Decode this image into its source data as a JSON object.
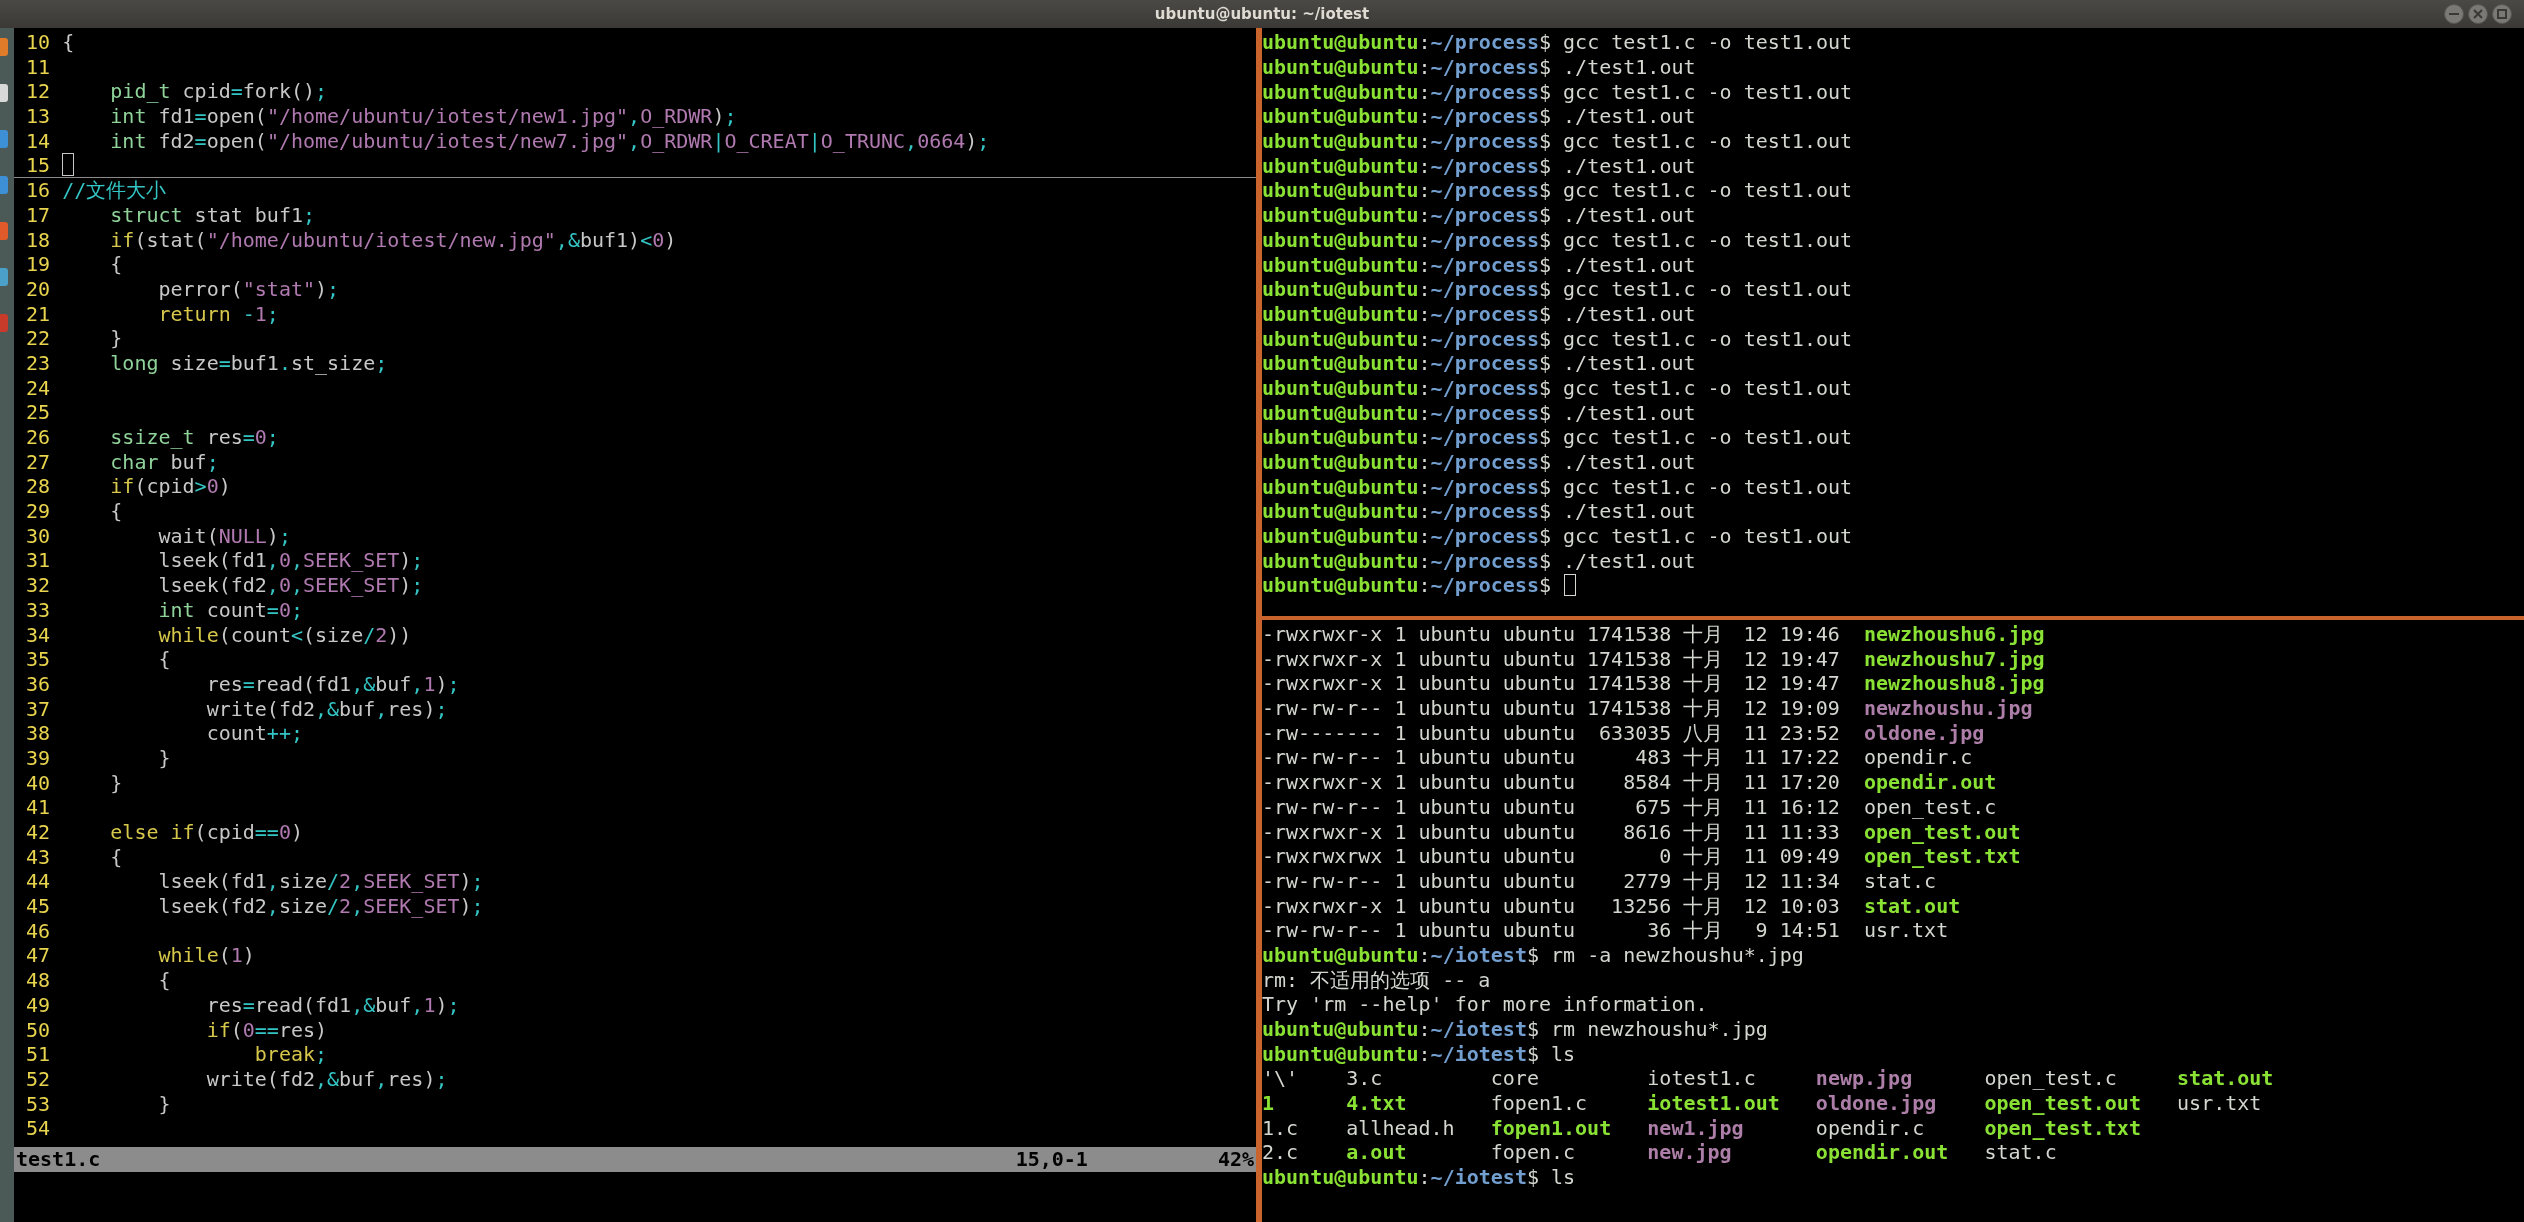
{
  "window": {
    "title": "ubuntu@ubuntu: ~/iotest"
  },
  "editor": {
    "lines": [
      {
        "number": "10",
        "cursor": false,
        "segments": [
          {
            "kind": "plain",
            "text": "{"
          }
        ]
      },
      {
        "number": "11",
        "cursor": false
      },
      {
        "number": "12",
        "cursor": false,
        "segments": [
          {
            "kind": "type",
            "text": "    pid_t"
          },
          {
            "kind": "plain",
            "text": " cpid"
          },
          {
            "kind": "operator",
            "text": "="
          },
          {
            "kind": "plain",
            "text": "fork()"
          },
          {
            "kind": "operator",
            "text": ";"
          }
        ]
      },
      {
        "number": "13",
        "cursor": false,
        "segments": [
          {
            "kind": "type",
            "text": "    int"
          },
          {
            "kind": "plain",
            "text": " fd1"
          },
          {
            "kind": "operator",
            "text": "="
          },
          {
            "kind": "plain",
            "text": "open("
          },
          {
            "kind": "string",
            "text": "\"/home/ubuntu/iotest/new1.jpg\""
          },
          {
            "kind": "operator",
            "text": ","
          },
          {
            "kind": "constant",
            "text": "O_RDWR"
          },
          {
            "kind": "plain",
            "text": ")"
          },
          {
            "kind": "operator",
            "text": ";"
          }
        ]
      },
      {
        "number": "14",
        "cursor": false,
        "segments": [
          {
            "kind": "type",
            "text": "    int"
          },
          {
            "kind": "plain",
            "text": " fd2"
          },
          {
            "kind": "operator",
            "text": "="
          },
          {
            "kind": "plain",
            "text": "open("
          },
          {
            "kind": "string",
            "text": "\"/home/ubuntu/iotest/new7.jpg\""
          },
          {
            "kind": "operator",
            "text": ","
          },
          {
            "kind": "constant",
            "text": "O_RDWR"
          },
          {
            "kind": "operator",
            "text": "|"
          },
          {
            "kind": "constant",
            "text": "O_CREAT"
          },
          {
            "kind": "operator",
            "text": "|"
          },
          {
            "kind": "constant",
            "text": "O_TRUNC"
          },
          {
            "kind": "operator",
            "text": ","
          },
          {
            "kind": "number",
            "text": "0664"
          },
          {
            "kind": "plain",
            "text": ")"
          },
          {
            "kind": "operator",
            "text": ";"
          }
        ]
      },
      {
        "number": "15",
        "cursor": true
      },
      {
        "number": "16",
        "cursor": false,
        "segments": [
          {
            "kind": "comment",
            "text": "//文件大小"
          }
        ]
      },
      {
        "number": "17",
        "cursor": false,
        "segments": [
          {
            "kind": "type",
            "text": "    struct"
          },
          {
            "kind": "plain",
            "text": " stat buf1"
          },
          {
            "kind": "operator",
            "text": ";"
          }
        ]
      },
      {
        "number": "18",
        "cursor": false,
        "segments": [
          {
            "kind": "keyword",
            "text": "    if"
          },
          {
            "kind": "plain",
            "text": "(stat("
          },
          {
            "kind": "string",
            "text": "\"/home/ubuntu/iotest/new.jpg\""
          },
          {
            "kind": "operator",
            "text": ",&"
          },
          {
            "kind": "plain",
            "text": "buf1)"
          },
          {
            "kind": "operator",
            "text": "<"
          },
          {
            "kind": "number",
            "text": "0"
          },
          {
            "kind": "plain",
            "text": ")"
          }
        ]
      },
      {
        "number": "19",
        "cursor": false,
        "segments": [
          {
            "kind": "plain",
            "text": "    {"
          }
        ]
      },
      {
        "number": "20",
        "cursor": false,
        "segments": [
          {
            "kind": "plain",
            "text": "        perror("
          },
          {
            "kind": "string",
            "text": "\"stat\""
          },
          {
            "kind": "plain",
            "text": ")"
          },
          {
            "kind": "operator",
            "text": ";"
          }
        ]
      },
      {
        "number": "21",
        "cursor": false,
        "segments": [
          {
            "kind": "keyword",
            "text": "        return"
          },
          {
            "kind": "operator",
            "text": " -"
          },
          {
            "kind": "number",
            "text": "1"
          },
          {
            "kind": "operator",
            "text": ";"
          }
        ]
      },
      {
        "number": "22",
        "cursor": false,
        "segments": [
          {
            "kind": "plain",
            "text": "    }"
          }
        ]
      },
      {
        "number": "23",
        "cursor": false,
        "segments": [
          {
            "kind": "type",
            "text": "    long"
          },
          {
            "kind": "plain",
            "text": " size"
          },
          {
            "kind": "operator",
            "text": "="
          },
          {
            "kind": "plain",
            "text": "buf1"
          },
          {
            "kind": "operator",
            "text": "."
          },
          {
            "kind": "plain",
            "text": "st_size"
          },
          {
            "kind": "operator",
            "text": ";"
          }
        ]
      },
      {
        "number": "24",
        "cursor": false
      },
      {
        "number": "25",
        "cursor": false
      },
      {
        "number": "26",
        "cursor": false,
        "segments": [
          {
            "kind": "type",
            "text": "    ssize_t"
          },
          {
            "kind": "plain",
            "text": " res"
          },
          {
            "kind": "operator",
            "text": "="
          },
          {
            "kind": "number",
            "text": "0"
          },
          {
            "kind": "operator",
            "text": ";"
          }
        ]
      },
      {
        "number": "27",
        "cursor": false,
        "segments": [
          {
            "kind": "type",
            "text": "    char"
          },
          {
            "kind": "plain",
            "text": " buf"
          },
          {
            "kind": "operator",
            "text": ";"
          }
        ]
      },
      {
        "number": "28",
        "cursor": false,
        "segments": [
          {
            "kind": "keyword",
            "text": "    if"
          },
          {
            "kind": "plain",
            "text": "(cpid"
          },
          {
            "kind": "operator",
            "text": ">"
          },
          {
            "kind": "number",
            "text": "0"
          },
          {
            "kind": "plain",
            "text": ")"
          }
        ]
      },
      {
        "number": "29",
        "cursor": false,
        "segments": [
          {
            "kind": "plain",
            "text": "    {"
          }
        ]
      },
      {
        "number": "30",
        "cursor": false,
        "segments": [
          {
            "kind": "plain",
            "text": "        wait("
          },
          {
            "kind": "constant",
            "text": "NULL"
          },
          {
            "kind": "plain",
            "text": ")"
          },
          {
            "kind": "operator",
            "text": ";"
          }
        ]
      },
      {
        "number": "31",
        "cursor": false,
        "segments": [
          {
            "kind": "plain",
            "text": "        lseek(fd1"
          },
          {
            "kind": "operator",
            "text": ","
          },
          {
            "kind": "number",
            "text": "0"
          },
          {
            "kind": "operator",
            "text": ","
          },
          {
            "kind": "constant",
            "text": "SEEK_SET"
          },
          {
            "kind": "plain",
            "text": ")"
          },
          {
            "kind": "operator",
            "text": ";"
          }
        ]
      },
      {
        "number": "32",
        "cursor": false,
        "segments": [
          {
            "kind": "plain",
            "text": "        lseek(fd2"
          },
          {
            "kind": "operator",
            "text": ","
          },
          {
            "kind": "number",
            "text": "0"
          },
          {
            "kind": "operator",
            "text": ","
          },
          {
            "kind": "constant",
            "text": "SEEK_SET"
          },
          {
            "kind": "plain",
            "text": ")"
          },
          {
            "kind": "operator",
            "text": ";"
          }
        ]
      },
      {
        "number": "33",
        "cursor": false,
        "segments": [
          {
            "kind": "type",
            "text": "        int"
          },
          {
            "kind": "plain",
            "text": " count"
          },
          {
            "kind": "operator",
            "text": "="
          },
          {
            "kind": "number",
            "text": "0"
          },
          {
            "kind": "operator",
            "text": ";"
          }
        ]
      },
      {
        "number": "34",
        "cursor": false,
        "segments": [
          {
            "kind": "keyword",
            "text": "        while"
          },
          {
            "kind": "plain",
            "text": "(count"
          },
          {
            "kind": "operator",
            "text": "<"
          },
          {
            "kind": "plain",
            "text": "(size"
          },
          {
            "kind": "operator",
            "text": "/"
          },
          {
            "kind": "number",
            "text": "2"
          },
          {
            "kind": "plain",
            "text": "))"
          }
        ]
      },
      {
        "number": "35",
        "cursor": false,
        "segments": [
          {
            "kind": "plain",
            "text": "        {"
          }
        ]
      },
      {
        "number": "36",
        "cursor": false,
        "segments": [
          {
            "kind": "plain",
            "text": "            res"
          },
          {
            "kind": "operator",
            "text": "="
          },
          {
            "kind": "plain",
            "text": "read(fd1"
          },
          {
            "kind": "operator",
            "text": ",&"
          },
          {
            "kind": "plain",
            "text": "buf"
          },
          {
            "kind": "operator",
            "text": ","
          },
          {
            "kind": "number",
            "text": "1"
          },
          {
            "kind": "plain",
            "text": ")"
          },
          {
            "kind": "operator",
            "text": ";"
          }
        ]
      },
      {
        "number": "37",
        "cursor": false,
        "segments": [
          {
            "kind": "plain",
            "text": "            write(fd2"
          },
          {
            "kind": "operator",
            "text": ",&"
          },
          {
            "kind": "plain",
            "text": "buf"
          },
          {
            "kind": "operator",
            "text": ","
          },
          {
            "kind": "plain",
            "text": "res)"
          },
          {
            "kind": "operator",
            "text": ";"
          }
        ]
      },
      {
        "number": "38",
        "cursor": false,
        "segments": [
          {
            "kind": "plain",
            "text": "            count"
          },
          {
            "kind": "operator",
            "text": "++;"
          }
        ]
      },
      {
        "number": "39",
        "cursor": false,
        "segments": [
          {
            "kind": "plain",
            "text": "        }"
          }
        ]
      },
      {
        "number": "40",
        "cursor": false,
        "segments": [
          {
            "kind": "plain",
            "text": "    }"
          }
        ]
      },
      {
        "number": "41",
        "cursor": false
      },
      {
        "number": "42",
        "cursor": false,
        "segments": [
          {
            "kind": "keyword",
            "text": "    else if"
          },
          {
            "kind": "plain",
            "text": "(cpid"
          },
          {
            "kind": "operator",
            "text": "=="
          },
          {
            "kind": "number",
            "text": "0"
          },
          {
            "kind": "plain",
            "text": ")"
          }
        ]
      },
      {
        "number": "43",
        "cursor": false,
        "segments": [
          {
            "kind": "plain",
            "text": "    {"
          }
        ]
      },
      {
        "number": "44",
        "cursor": false,
        "segments": [
          {
            "kind": "plain",
            "text": "        lseek(fd1"
          },
          {
            "kind": "operator",
            "text": ","
          },
          {
            "kind": "plain",
            "text": "size"
          },
          {
            "kind": "operator",
            "text": "/"
          },
          {
            "kind": "number",
            "text": "2"
          },
          {
            "kind": "operator",
            "text": ","
          },
          {
            "kind": "constant",
            "text": "SEEK_SET"
          },
          {
            "kind": "plain",
            "text": ")"
          },
          {
            "kind": "operator",
            "text": ";"
          }
        ]
      },
      {
        "number": "45",
        "cursor": false,
        "segments": [
          {
            "kind": "plain",
            "text": "        lseek(fd2"
          },
          {
            "kind": "operator",
            "text": ","
          },
          {
            "kind": "plain",
            "text": "size"
          },
          {
            "kind": "operator",
            "text": "/"
          },
          {
            "kind": "number",
            "text": "2"
          },
          {
            "kind": "operator",
            "text": ","
          },
          {
            "kind": "constant",
            "text": "SEEK_SET"
          },
          {
            "kind": "plain",
            "text": ")"
          },
          {
            "kind": "operator",
            "text": ";"
          }
        ]
      },
      {
        "number": "46",
        "cursor": false
      },
      {
        "number": "47",
        "cursor": false,
        "segments": [
          {
            "kind": "keyword",
            "text": "        while"
          },
          {
            "kind": "plain",
            "text": "("
          },
          {
            "kind": "number",
            "text": "1"
          },
          {
            "kind": "plain",
            "text": ")"
          }
        ]
      },
      {
        "number": "48",
        "cursor": false,
        "segments": [
          {
            "kind": "plain",
            "text": "        {"
          }
        ]
      },
      {
        "number": "49",
        "cursor": false,
        "segments": [
          {
            "kind": "plain",
            "text": "            res"
          },
          {
            "kind": "operator",
            "text": "="
          },
          {
            "kind": "plain",
            "text": "read(fd1"
          },
          {
            "kind": "operator",
            "text": ",&"
          },
          {
            "kind": "plain",
            "text": "buf"
          },
          {
            "kind": "operator",
            "text": ","
          },
          {
            "kind": "number",
            "text": "1"
          },
          {
            "kind": "plain",
            "text": ")"
          },
          {
            "kind": "operator",
            "text": ";"
          }
        ]
      },
      {
        "number": "50",
        "cursor": false,
        "segments": [
          {
            "kind": "keyword",
            "text": "            if"
          },
          {
            "kind": "plain",
            "text": "("
          },
          {
            "kind": "number",
            "text": "0"
          },
          {
            "kind": "operator",
            "text": "=="
          },
          {
            "kind": "plain",
            "text": "res)"
          }
        ]
      },
      {
        "number": "51",
        "cursor": false,
        "segments": [
          {
            "kind": "keyword",
            "text": "                break"
          },
          {
            "kind": "operator",
            "text": ";"
          }
        ]
      },
      {
        "number": "52",
        "cursor": false,
        "segments": [
          {
            "kind": "plain",
            "text": "            write(fd2"
          },
          {
            "kind": "operator",
            "text": ",&"
          },
          {
            "kind": "plain",
            "text": "buf"
          },
          {
            "kind": "operator",
            "text": ","
          },
          {
            "kind": "plain",
            "text": "res)"
          },
          {
            "kind": "operator",
            "text": ";"
          }
        ]
      },
      {
        "number": "53",
        "cursor": false,
        "segments": [
          {
            "kind": "plain",
            "text": "        }"
          }
        ]
      },
      {
        "number": "54",
        "cursor": false
      }
    ],
    "status_bar": {
      "file": "test1.c",
      "position": "15,0-1",
      "scroll": "42%"
    }
  },
  "terminal_top": {
    "lines": [
      {
        "user": "ubuntu@ubuntu",
        "colon": ":",
        "path": "~/process",
        "dollar": "$",
        "command": "gcc test1.c -o test1.out",
        "cursor": false
      },
      {
        "user": "ubuntu@ubuntu",
        "colon": ":",
        "path": "~/process",
        "dollar": "$",
        "command": "./test1.out",
        "cursor": false
      },
      {
        "user": "ubuntu@ubuntu",
        "colon": ":",
        "path": "~/process",
        "dollar": "$",
        "command": "gcc test1.c -o test1.out",
        "cursor": false
      },
      {
        "user": "ubuntu@ubuntu",
        "colon": ":",
        "path": "~/process",
        "dollar": "$",
        "command": "./test1.out",
        "cursor": false
      },
      {
        "user": "ubuntu@ubuntu",
        "colon": ":",
        "path": "~/process",
        "dollar": "$",
        "command": "gcc test1.c -o test1.out",
        "cursor": false
      },
      {
        "user": "ubuntu@ubuntu",
        "colon": ":",
        "path": "~/process",
        "dollar": "$",
        "command": "./test1.out",
        "cursor": false
      },
      {
        "user": "ubuntu@ubuntu",
        "colon": ":",
        "path": "~/process",
        "dollar": "$",
        "command": "gcc test1.c -o test1.out",
        "cursor": false
      },
      {
        "user": "ubuntu@ubuntu",
        "colon": ":",
        "path": "~/process",
        "dollar": "$",
        "command": "./test1.out",
        "cursor": false
      },
      {
        "user": "ubuntu@ubuntu",
        "colon": ":",
        "path": "~/process",
        "dollar": "$",
        "command": "gcc test1.c -o test1.out",
        "cursor": false
      },
      {
        "user": "ubuntu@ubuntu",
        "colon": ":",
        "path": "~/process",
        "dollar": "$",
        "command": "./test1.out",
        "cursor": false
      },
      {
        "user": "ubuntu@ubuntu",
        "colon": ":",
        "path": "~/process",
        "dollar": "$",
        "command": "gcc test1.c -o test1.out",
        "cursor": false
      },
      {
        "user": "ubuntu@ubuntu",
        "colon": ":",
        "path": "~/process",
        "dollar": "$",
        "command": "./test1.out",
        "cursor": false
      },
      {
        "user": "ubuntu@ubuntu",
        "colon": ":",
        "path": "~/process",
        "dollar": "$",
        "command": "gcc test1.c -o test1.out",
        "cursor": false
      },
      {
        "user": "ubuntu@ubuntu",
        "colon": ":",
        "path": "~/process",
        "dollar": "$",
        "command": "./test1.out",
        "cursor": false
      },
      {
        "user": "ubuntu@ubuntu",
        "colon": ":",
        "path": "~/process",
        "dollar": "$",
        "command": "gcc test1.c -o test1.out",
        "cursor": false
      },
      {
        "user": "ubuntu@ubuntu",
        "colon": ":",
        "path": "~/process",
        "dollar": "$",
        "command": "./test1.out",
        "cursor": false
      },
      {
        "user": "ubuntu@ubuntu",
        "colon": ":",
        "path": "~/process",
        "dollar": "$",
        "command": "gcc test1.c -o test1.out",
        "cursor": false
      },
      {
        "user": "ubuntu@ubuntu",
        "colon": ":",
        "path": "~/process",
        "dollar": "$",
        "command": "./test1.out",
        "cursor": false
      },
      {
        "user": "ubuntu@ubuntu",
        "colon": ":",
        "path": "~/process",
        "dollar": "$",
        "command": "gcc test1.c -o test1.out",
        "cursor": false
      },
      {
        "user": "ubuntu@ubuntu",
        "colon": ":",
        "path": "~/process",
        "dollar": "$",
        "command": "./test1.out",
        "cursor": false
      },
      {
        "user": "ubuntu@ubuntu",
        "colon": ":",
        "path": "~/process",
        "dollar": "$",
        "command": "gcc test1.c -o test1.out",
        "cursor": false
      },
      {
        "user": "ubuntu@ubuntu",
        "colon": ":",
        "path": "~/process",
        "dollar": "$",
        "command": "./test1.out",
        "cursor": false
      },
      {
        "user": "ubuntu@ubuntu",
        "colon": ":",
        "path": "~/process",
        "dollar": "$",
        "cursor": true
      }
    ]
  },
  "terminal_bottom": {
    "lines": [
      {
        "kind": "file",
        "mode": "-rwxrwxr-x",
        "links": "1",
        "owner": "ubuntu",
        "group": "ubuntu",
        "size": "1741538",
        "month": "十月",
        "day": "12",
        "time": "19:46",
        "name": {
          "text": "newzhoushu6.jpg",
          "kind": "exec"
        }
      },
      {
        "kind": "file",
        "mode": "-rwxrwxr-x",
        "links": "1",
        "owner": "ubuntu",
        "group": "ubuntu",
        "size": "1741538",
        "month": "十月",
        "day": "12",
        "time": "19:47",
        "name": {
          "text": "newzhoushu7.jpg",
          "kind": "exec"
        }
      },
      {
        "kind": "file",
        "mode": "-rwxrwxr-x",
        "links": "1",
        "owner": "ubuntu",
        "group": "ubuntu",
        "size": "1741538",
        "month": "十月",
        "day": "12",
        "time": "19:47",
        "name": {
          "text": "newzhoushu8.jpg",
          "kind": "exec"
        }
      },
      {
        "kind": "file",
        "mode": "-rw-rw-r--",
        "links": "1",
        "owner": "ubuntu",
        "group": "ubuntu",
        "size": "1741538",
        "month": "十月",
        "day": "12",
        "time": "19:09",
        "name": {
          "text": "newzhoushu.jpg",
          "kind": "image"
        }
      },
      {
        "kind": "file",
        "mode": "-rw-------",
        "links": "1",
        "owner": "ubuntu",
        "group": "ubuntu",
        "size": "633035",
        "month": "八月",
        "day": "11",
        "time": "23:52",
        "name": {
          "text": "oldone.jpg",
          "kind": "image"
        }
      },
      {
        "kind": "file",
        "mode": "-rw-rw-r--",
        "links": "1",
        "owner": "ubuntu",
        "group": "ubuntu",
        "size": "483",
        "month": "十月",
        "day": "11",
        "time": "17:22",
        "name": {
          "text": "opendir.c",
          "kind": "plain"
        }
      },
      {
        "kind": "file",
        "mode": "-rwxrwxr-x",
        "links": "1",
        "owner": "ubuntu",
        "group": "ubuntu",
        "size": "8584",
        "month": "十月",
        "day": "11",
        "time": "17:20",
        "name": {
          "text": "opendir.out",
          "kind": "exec"
        }
      },
      {
        "kind": "file",
        "mode": "-rw-rw-r--",
        "links": "1",
        "owner": "ubuntu",
        "group": "ubuntu",
        "size": "675",
        "month": "十月",
        "day": "11",
        "time": "16:12",
        "name": {
          "text": "open_test.c",
          "kind": "plain"
        }
      },
      {
        "kind": "file",
        "mode": "-rwxrwxr-x",
        "links": "1",
        "owner": "ubuntu",
        "group": "ubuntu",
        "size": "8616",
        "month": "十月",
        "day": "11",
        "time": "11:33",
        "name": {
          "text": "open_test.out",
          "kind": "exec"
        }
      },
      {
        "kind": "file",
        "mode": "-rwxrwxrwx",
        "links": "1",
        "owner": "ubuntu",
        "group": "ubuntu",
        "size": "0",
        "month": "十月",
        "day": "11",
        "time": "09:49",
        "name": {
          "text": "open_test.txt",
          "kind": "exec"
        }
      },
      {
        "kind": "file",
        "mode": "-rw-rw-r--",
        "links": "1",
        "owner": "ubuntu",
        "group": "ubuntu",
        "size": "2779",
        "month": "十月",
        "day": "12",
        "time": "11:34",
        "name": {
          "text": "stat.c",
          "kind": "plain"
        }
      },
      {
        "kind": "file",
        "mode": "-rwxrwxr-x",
        "links": "1",
        "owner": "ubuntu",
        "group": "ubuntu",
        "size": "13256",
        "month": "十月",
        "day": "12",
        "time": "10:03",
        "name": {
          "text": "stat.out",
          "kind": "exec"
        }
      },
      {
        "kind": "file",
        "mode": "-rw-rw-r--",
        "links": "1",
        "owner": "ubuntu",
        "group": "ubuntu",
        "size": "36",
        "month": "十月",
        "day": "9",
        "time": "14:51",
        "name": {
          "text": "usr.txt",
          "kind": "plain"
        }
      },
      {
        "kind": "prompt",
        "user": "ubuntu@ubuntu",
        "colon": ":",
        "path": "~/iotest",
        "dollar": "$",
        "command": "rm -a newzhoushu*.jpg"
      },
      {
        "kind": "output",
        "text": "rm: 不适用的选项 -- a"
      },
      {
        "kind": "output",
        "text": "Try 'rm --help' for more information."
      },
      {
        "kind": "prompt",
        "user": "ubuntu@ubuntu",
        "colon": ":",
        "path": "~/iotest",
        "dollar": "$",
        "command": "rm newzhoushu*.jpg"
      },
      {
        "kind": "prompt",
        "user": "ubuntu@ubuntu",
        "colon": ":",
        "path": "~/iotest",
        "dollar": "$",
        "command": "ls"
      },
      {
        "kind": "grid",
        "columns": [
          [
            {
              "name": "'\\'",
              "kind": "plain"
            },
            {
              "name": "1",
              "kind": "exec"
            },
            {
              "name": "1.c",
              "kind": "plain"
            },
            {
              "name": "2.c",
              "kind": "plain"
            }
          ],
          [
            {
              "name": "3.c",
              "kind": "plain"
            },
            {
              "name": "4.txt",
              "kind": "exec"
            },
            {
              "name": "allhead.h",
              "kind": "plain"
            },
            {
              "name": "a.out",
              "kind": "exec"
            }
          ],
          [
            {
              "name": "core",
              "kind": "plain"
            },
            {
              "name": "fopen1.c",
              "kind": "plain"
            },
            {
              "name": "fopen1.out",
              "kind": "exec"
            },
            {
              "name": "fopen.c",
              "kind": "plain"
            }
          ],
          [
            {
              "name": "iotest1.c",
              "kind": "plain"
            },
            {
              "name": "iotest1.out",
              "kind": "exec"
            },
            {
              "name": "new1.jpg",
              "kind": "image"
            },
            {
              "name": "new.jpg",
              "kind": "image"
            }
          ],
          [
            {
              "name": "newp.jpg",
              "kind": "image"
            },
            {
              "name": "oldone.jpg",
              "kind": "image"
            },
            {
              "name": "opendir.c",
              "kind": "plain"
            },
            {
              "name": "opendir.out",
              "kind": "exec"
            }
          ],
          [
            {
              "name": "open_test.c",
              "kind": "plain"
            },
            {
              "name": "open_test.out",
              "kind": "exec"
            },
            {
              "name": "open_test.txt",
              "kind": "exec"
            },
            {
              "name": "stat.c",
              "kind": "plain"
            }
          ],
          [
            {
              "name": "stat.out",
              "kind": "exec"
            },
            {
              "name": "usr.txt",
              "kind": "plain"
            }
          ]
        ]
      },
      {
        "kind": "prompt",
        "user": "ubuntu@ubuntu",
        "colon": ":",
        "path": "~/iotest",
        "dollar": "$",
        "command": "ls"
      }
    ]
  }
}
